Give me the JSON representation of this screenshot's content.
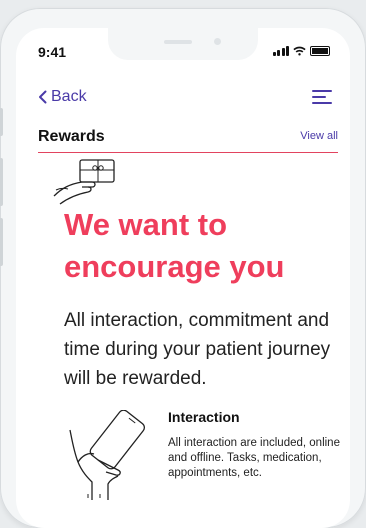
{
  "status_bar": {
    "time": "9:41"
  },
  "nav": {
    "back_label": "Back"
  },
  "section": {
    "title": "Rewards",
    "view_all_label": "View all"
  },
  "hero": {
    "headline": "We want to encourage you",
    "intro": "All interaction, commitment and time during your patient journey will be rewarded."
  },
  "feature": {
    "title": "Interaction",
    "description": "All interaction are included, online and offline. Tasks, medication, appointments, etc."
  },
  "icons": [
    "chevron-left-icon",
    "menu-icon",
    "gift-card-hand-icon",
    "phone-hand-icon",
    "signal-icon",
    "wifi-icon",
    "battery-icon"
  ],
  "colors": {
    "accent": "#ef3e5c",
    "link": "#4a3aa8",
    "divider": "#e2435f"
  }
}
